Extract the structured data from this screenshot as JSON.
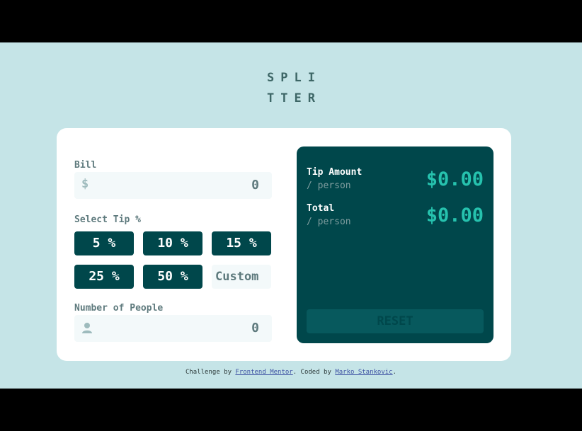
{
  "logo": {
    "line1": "SPLI",
    "line2": "TTER"
  },
  "bill": {
    "label": "Bill",
    "currency_icon": "$",
    "value": "0"
  },
  "tip": {
    "label": "Select Tip %",
    "options": [
      "5 %",
      "10 %",
      "15 %",
      "25 %",
      "50 %"
    ],
    "custom_placeholder": "Custom"
  },
  "people": {
    "label": "Number of People",
    "value": "0"
  },
  "results": {
    "tip_title": "Tip Amount",
    "tip_sub": "/ person",
    "tip_value": "$0.00",
    "total_title": "Total",
    "total_sub": "/ person",
    "total_value": "$0.00",
    "reset_label": "RESET"
  },
  "footer": {
    "prefix": "Challenge by ",
    "link1": "Frontend Mentor",
    "middle": ". Coded by ",
    "link2": "Marko Stankovic",
    "suffix": "."
  },
  "colors": {
    "background": "#c5e4e7",
    "primary": "#00474b",
    "accent": "#26c2ae"
  }
}
